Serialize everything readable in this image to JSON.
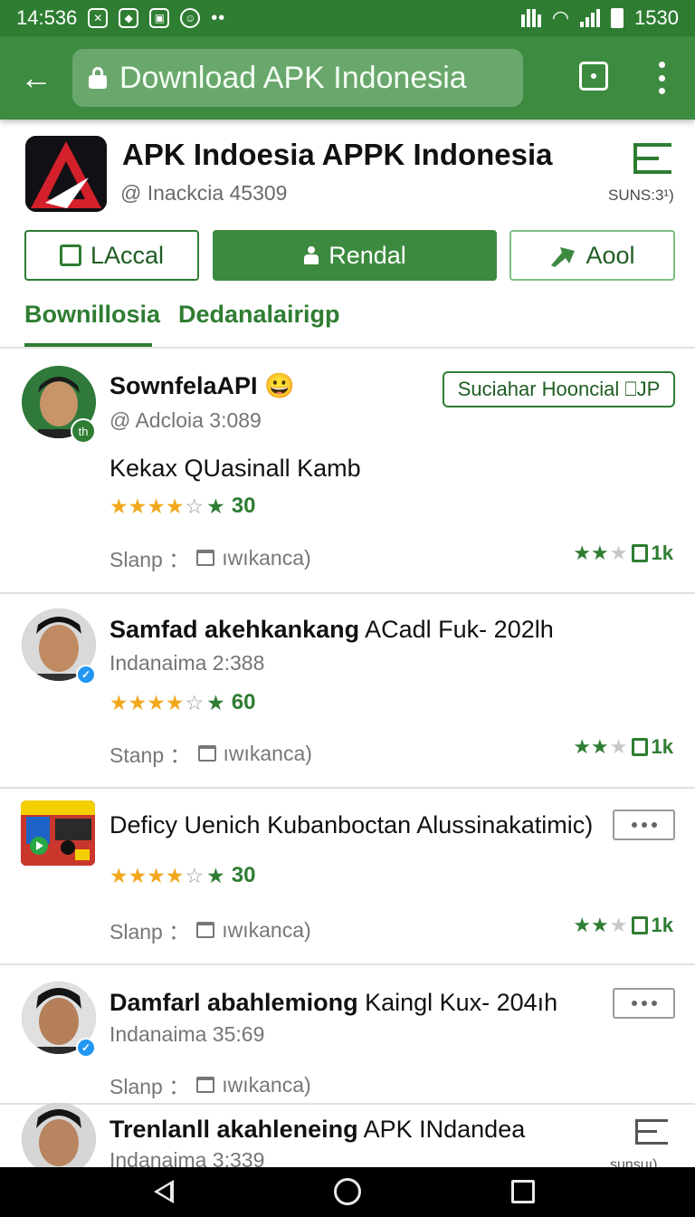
{
  "status_bar": {
    "time": "14:536",
    "dots": "••",
    "clock_right": "1530",
    "colors": {
      "bar": "#2e7d32"
    }
  },
  "app_bar": {
    "back_icon": "arrow-left-icon",
    "url_text": "Download APK Indonesia",
    "tabs_icon": "tabs-icon",
    "menu_icon": "more-vert-icon"
  },
  "header": {
    "title": "APK Indoesia APPK Indonesia",
    "subtitle": "@ Inackcia 45309",
    "count_label": "SUNS:3¹)",
    "buttons": [
      {
        "label": "LAccal",
        "icon": "share-box-icon"
      },
      {
        "label": "Rendal",
        "icon": "person-icon"
      },
      {
        "label": "Aool",
        "icon": "arrow-forward-icon"
      }
    ]
  },
  "tabs": [
    {
      "label": "Bownillosia",
      "active": true
    },
    {
      "label": "Dedanalairigp",
      "active": false
    }
  ],
  "items": [
    {
      "title": "SownfelaAPI",
      "title_emoji": "😀",
      "meta": "@ Adcloia 3:089",
      "description": "Kekax QUasinall Kamb",
      "stars_text": "★★★★",
      "star_off": "☆",
      "star_extra": "★",
      "rating": "30",
      "chip": "Suciahar Hooncial ⎕JP",
      "stamp": "Slanp ：",
      "stamp_tail": "ıwıkanca)",
      "right_stars_on": "★★",
      "right_stars_off": "★",
      "right_suffix": "1k",
      "badge": "th"
    },
    {
      "title_bold": "Samfad akehkankang",
      "title_rest": " ACadl Fuk- 202lh",
      "meta": "Indanaima 2:388",
      "stars_text": "★★★★",
      "star_off": "☆",
      "star_extra": "★",
      "rating": "60",
      "stamp": "Stanp ：",
      "stamp_tail": "ıwıkanca)",
      "right_stars_on": "★★",
      "right_stars_off": "★",
      "right_suffix": "1k"
    },
    {
      "title": "Deficy Uenich Kubanboctan Alussinakatimic)",
      "stars_text": "★★★★",
      "star_off": "☆",
      "star_extra": "★",
      "rating": "30",
      "stamp": "Slanp ：",
      "stamp_tail": "ıwıkanca)",
      "right_stars_on": "★★",
      "right_stars_off": "★",
      "right_suffix": "1k"
    },
    {
      "title_bold": "Damfarl abahlemiong",
      "title_rest": " Kaingl Kux- 204ıh",
      "meta": "Indanaima 35:69",
      "stamp": "Slanp ：",
      "stamp_tail": "ıwıkanca)"
    },
    {
      "title_bold": "Trenlanll akahleneing",
      "title_rest": " APK INdandea",
      "meta": "Indanaima 3:339",
      "float_label": "sunsuı)"
    }
  ],
  "nav": {
    "back": "nav-back-icon",
    "home": "nav-home-icon",
    "recent": "nav-recent-icon"
  },
  "colors": {
    "accent": "#2e7d32",
    "app_bar": "#3d8b40",
    "star": "#f2a81d",
    "verified": "#2196f3"
  }
}
